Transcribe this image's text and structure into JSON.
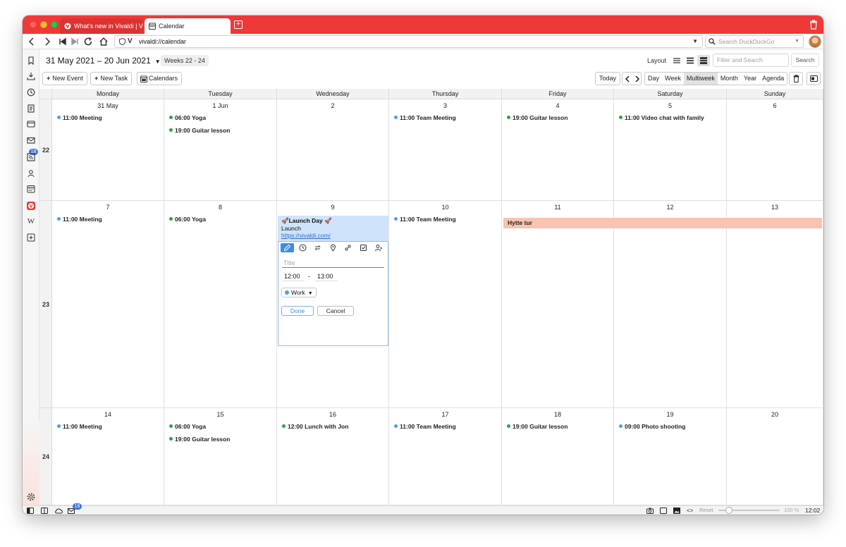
{
  "tabs": [
    {
      "label": "What's new in Vivaldi | Vivaldi"
    },
    {
      "label": "Calendar"
    }
  ],
  "address": {
    "url": "vivaldi://calendar"
  },
  "search": {
    "placeholder": "Search DuckDuckGo"
  },
  "sidebar_badge": "18",
  "calendar": {
    "date_range": "31 May 2021 – 20 Jun 2021",
    "weeks_label": "Weeks 22 - 24",
    "layout_label": "Layout",
    "filter_placeholder": "Filter and Search",
    "search_button": "Search",
    "new_event": "New Event",
    "new_task": "New Task",
    "calendars": "Calendars",
    "today": "Today",
    "views": [
      "Day",
      "Week",
      "Multiweek",
      "Month",
      "Year",
      "Agenda"
    ],
    "active_view": "Multiweek",
    "weekdays": [
      "Monday",
      "Tuesday",
      "Wednesday",
      "Thursday",
      "Friday",
      "Saturday",
      "Sunday"
    ],
    "weeks": [
      {
        "number": "22",
        "days": [
          {
            "label": "31 May",
            "events": [
              {
                "text": "11:00 Meeting",
                "color": "#4a9de8"
              }
            ]
          },
          {
            "label": "1 Jun",
            "events": [
              {
                "text": "06:00 Yoga",
                "color": "#2ea043"
              },
              {
                "text": "19:00 Guitar lesson",
                "color": "#2ea043"
              }
            ]
          },
          {
            "label": "2",
            "events": []
          },
          {
            "label": "3",
            "events": [
              {
                "text": "11:00 Team Meeting",
                "color": "#4a9de8"
              }
            ]
          },
          {
            "label": "4",
            "events": [
              {
                "text": "19:00 Guitar lesson",
                "color": "#2ea043"
              }
            ]
          },
          {
            "label": "5",
            "events": [
              {
                "text": "11:00 Video chat with family",
                "color": "#2ea043"
              }
            ]
          },
          {
            "label": "6",
            "events": []
          }
        ]
      },
      {
        "number": "23",
        "days": [
          {
            "label": "7",
            "events": [
              {
                "text": "11:00 Meeting",
                "color": "#4a9de8"
              }
            ]
          },
          {
            "label": "8",
            "events": [
              {
                "text": "06:00 Yoga",
                "color": "#2ea043"
              }
            ]
          },
          {
            "label": "9",
            "events": []
          },
          {
            "label": "10",
            "events": [
              {
                "text": "11:00 Team Meeting",
                "color": "#4a9de8"
              }
            ]
          },
          {
            "label": "11",
            "events": []
          },
          {
            "label": "12",
            "events": []
          },
          {
            "label": "13",
            "events": []
          }
        ]
      },
      {
        "number": "24",
        "days": [
          {
            "label": "14",
            "events": [
              {
                "text": "11:00 Meeting",
                "color": "#4a9de8"
              }
            ]
          },
          {
            "label": "15",
            "events": [
              {
                "text": "06:00 Yoga",
                "color": "#2ea043"
              },
              {
                "text": "19:00 Guitar lesson",
                "color": "#2ea043"
              }
            ]
          },
          {
            "label": "16",
            "events": [
              {
                "text": "12:00 Lunch with Jon",
                "color": "#2ea043"
              }
            ]
          },
          {
            "label": "17",
            "events": [
              {
                "text": "11:00 Team Meeting",
                "color": "#4a9de8"
              }
            ]
          },
          {
            "label": "18",
            "events": [
              {
                "text": "19:00 Guitar lesson",
                "color": "#2ea043"
              }
            ]
          },
          {
            "label": "19",
            "events": [
              {
                "text": "09:00 Photo shooting",
                "color": "#4a9de8"
              }
            ]
          },
          {
            "label": "20",
            "events": []
          }
        ]
      }
    ],
    "allday_event": {
      "title": "Hytte tur",
      "color": "#f8c3b0"
    },
    "launch_event": {
      "title": "🚀Launch Day 🚀",
      "description": "Launch",
      "link": "https://vivaldi.com/"
    },
    "editor": {
      "title_placeholder": "Title",
      "start_time": "12:00",
      "time_separator": "-",
      "end_time": "13:00",
      "calendar": "Work",
      "done": "Done",
      "cancel": "Cancel"
    }
  },
  "statusbar": {
    "badge": "18",
    "reset": "Reset",
    "zoom": "100 %",
    "time": "12:02"
  },
  "colors": {
    "tabbar": "#ef3939",
    "accent": "#3d8ce5",
    "blue_dot": "#4a9de8",
    "green_dot": "#2ea043"
  }
}
